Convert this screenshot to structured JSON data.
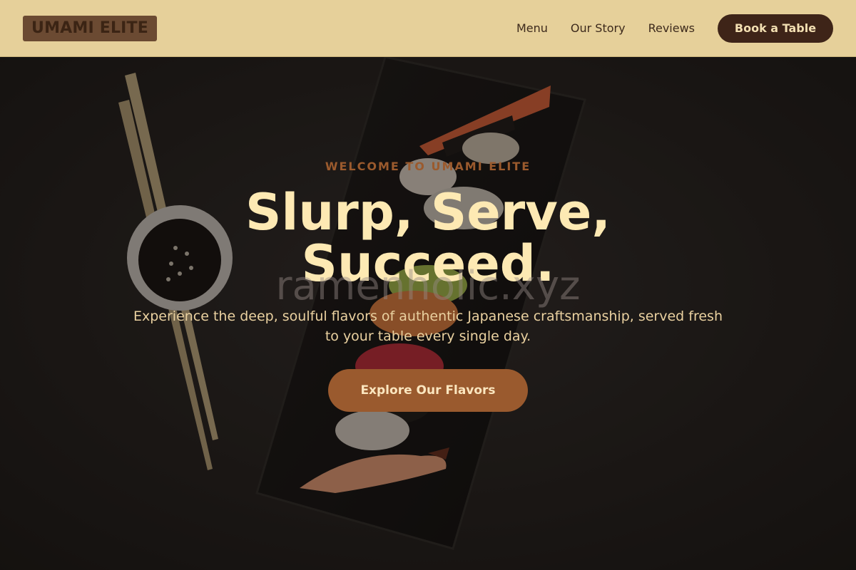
{
  "header": {
    "logo": "UMAMI ELITE",
    "nav": [
      "Menu",
      "Our Story",
      "Reviews"
    ],
    "book_label": "Book a Table"
  },
  "hero": {
    "eyebrow": "WELCOME TO UMAMI ELITE",
    "headline_line1": "Slurp, Serve,",
    "headline_line2": "Succeed.",
    "watermark": "ramenholic.xyz",
    "subtext": "Experience the deep, soulful flavors of authentic Japanese craftsmanship, served fresh to your table every single day.",
    "cta_label": "Explore Our Flavors"
  },
  "colors": {
    "header_bg": "#e6d09a",
    "book_button": "#3e2418",
    "cta_button": "#9a5a2e",
    "headline": "#fde9b3",
    "eyebrow": "#9b5a2d"
  }
}
